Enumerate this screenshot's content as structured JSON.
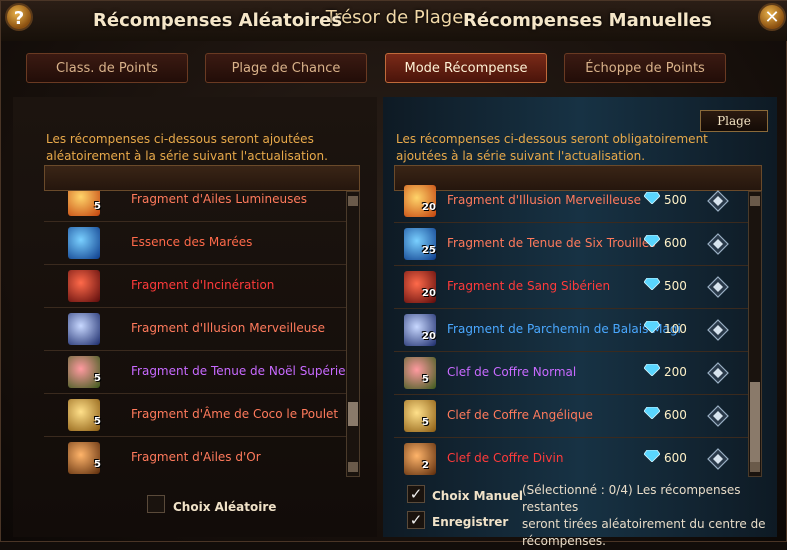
{
  "window": {
    "title": "Trésor de Plage",
    "help_label": "?",
    "close_label": "✕"
  },
  "tabs": [
    {
      "label": "Class. de Points"
    },
    {
      "label": "Plage de Chance"
    },
    {
      "label": "Mode Récompense",
      "active": true
    },
    {
      "label": "Échoppe de Points"
    }
  ],
  "left": {
    "title": "Récompenses Aléatoires",
    "desc_line1": "Les récompenses ci-dessous seront ajoutées",
    "desc_line2": "aléatoirement à la série suivant l'actualisation.",
    "items": [
      {
        "name": "Fragment d'Ailes Lumineuses",
        "qty": "5",
        "color": "#ff7a5c",
        "icon": "wings-gold-icon"
      },
      {
        "name": "Essence des Marées",
        "qty": "",
        "color": "#ff6a4a",
        "icon": "tide-essence-icon"
      },
      {
        "name": "Fragment d'Incinération",
        "qty": "",
        "color": "#ff3a3a",
        "icon": "incineration-icon"
      },
      {
        "name": "Fragment d'Illusion Merveilleuse",
        "qty": "",
        "color": "#ff7a5c",
        "icon": "illusion-icon"
      },
      {
        "name": "Fragment de Tenue de Noël Supérieure",
        "qty": "5",
        "color": "#c86aff",
        "icon": "christmas-outfit-icon"
      },
      {
        "name": "Fragment d'Âme de Coco le Poulet",
        "qty": "5",
        "color": "#ff7a5c",
        "icon": "chicken-soul-icon"
      },
      {
        "name": "Fragment d'Ailes d'Or",
        "qty": "5",
        "color": "#ff7a5c",
        "icon": "golden-wings-icon"
      }
    ],
    "checkbox_label": "Choix Aléatoire",
    "checkbox_checked": false
  },
  "right": {
    "title": "Récompenses Manuelles",
    "plage_label": "Plage",
    "desc_line1": "Les récompenses ci-dessous seront obligatoirement",
    "desc_line2": "ajoutées à la série suivant l'actualisation.",
    "items": [
      {
        "name": "Fragment d'Illusion Merveilleuse",
        "qty": "20",
        "price": "500",
        "color": "#ff7a5c",
        "icon": "illusion-icon"
      },
      {
        "name": "Fragment de Tenue de Six Trouilles",
        "qty": "25",
        "price": "600",
        "color": "#ff7a5c",
        "icon": "six-fears-outfit-icon"
      },
      {
        "name": "Fragment de Sang Sibérien",
        "qty": "20",
        "price": "500",
        "color": "#ff3a3a",
        "icon": "siberian-blood-icon"
      },
      {
        "name": "Fragment de Parchemin de Balais Magi",
        "qty": "20",
        "price": "100",
        "color": "#4aa8ff",
        "icon": "broom-scroll-icon"
      },
      {
        "name": "Clef de Coffre Normal",
        "qty": "5",
        "price": "200",
        "color": "#c86aff",
        "icon": "normal-chest-key-icon"
      },
      {
        "name": "Clef de Coffre Angélique",
        "qty": "5",
        "price": "600",
        "color": "#ff7a5c",
        "icon": "angelic-chest-key-icon"
      },
      {
        "name": "Clef de Coffre Divin",
        "qty": "2",
        "price": "600",
        "color": "#ff3a3a",
        "icon": "divine-chest-key-icon"
      }
    ],
    "choix_manuel_label": "Choix Manuel",
    "enregistrer_label": "Enregistrer",
    "choix_manuel_checked": true,
    "enregistrer_checked": true,
    "note_line1": "(Sélectionné : 0/4) Les récompenses restantes",
    "note_line2": "seront tirées aléatoirement du centre de",
    "note_line3": "récompenses."
  },
  "colors": {
    "title": "#f2d9a8",
    "desc": "#e8a94a",
    "price": "#fff2c8",
    "diamond": "#5ad6ff"
  }
}
